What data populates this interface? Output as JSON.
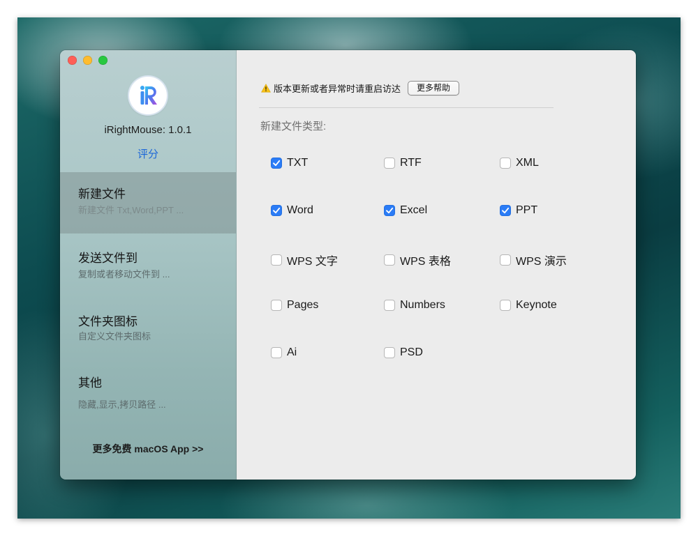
{
  "sidebar": {
    "app_version": "iRightMouse: 1.0.1",
    "rate_label": "评分",
    "items": [
      {
        "title": "新建文件",
        "subtitle": "新建文件 Txt,Word,PPT ..."
      },
      {
        "title": "发送文件到",
        "subtitle": "复制或者移动文件到 ..."
      },
      {
        "title": "文件夹图标",
        "subtitle": "自定义文件夹图标"
      },
      {
        "title": "其他",
        "subtitle": "隐藏,显示,拷贝路径 ..."
      }
    ],
    "more_apps_label": "更多免费 macOS App >>"
  },
  "content": {
    "notice_text": "版本更新或者异常时请重启访达",
    "help_button_label": "更多帮助",
    "section_label": "新建文件类型:",
    "file_types": [
      {
        "label": "TXT",
        "checked": true
      },
      {
        "label": "RTF",
        "checked": false
      },
      {
        "label": "XML",
        "checked": false
      },
      {
        "label": "Word",
        "checked": true
      },
      {
        "label": "Excel",
        "checked": true
      },
      {
        "label": "PPT",
        "checked": true
      },
      {
        "label": "WPS 文字",
        "checked": false
      },
      {
        "label": "WPS 表格",
        "checked": false
      },
      {
        "label": "WPS 演示",
        "checked": false
      },
      {
        "label": "Pages",
        "checked": false
      },
      {
        "label": "Numbers",
        "checked": false
      },
      {
        "label": "Keynote",
        "checked": false
      },
      {
        "label": "Ai",
        "checked": false
      },
      {
        "label": "PSD",
        "checked": false
      }
    ]
  },
  "icons": {
    "app_logo": "irightmouse-logo-icon",
    "warning": "warning-icon",
    "checkbox": "checkmark-icon"
  },
  "colors": {
    "accent": "#2b7cf6",
    "link": "#1d67d8",
    "close": "#fe5f57",
    "minimize": "#febc2e",
    "zoom": "#28c840"
  }
}
